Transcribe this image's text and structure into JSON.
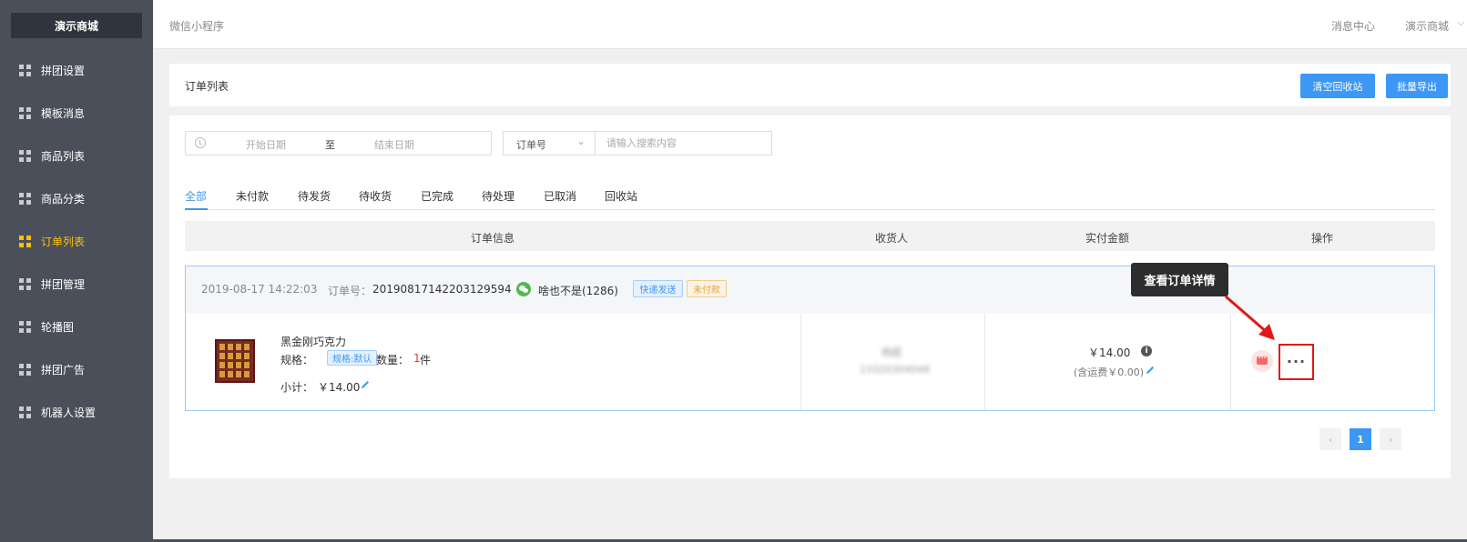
{
  "sidebar": {
    "brand": "演示商城",
    "items": [
      {
        "label": "拼团设置",
        "name": "sidebar-item-group-settings",
        "active": false
      },
      {
        "label": "模板消息",
        "name": "sidebar-item-template-messages",
        "active": false
      },
      {
        "label": "商品列表",
        "name": "sidebar-item-product-list",
        "active": false
      },
      {
        "label": "商品分类",
        "name": "sidebar-item-product-categories",
        "active": false
      },
      {
        "label": "订单列表",
        "name": "sidebar-item-order-list",
        "active": true
      },
      {
        "label": "拼团管理",
        "name": "sidebar-item-group-management",
        "active": false
      },
      {
        "label": "轮播图",
        "name": "sidebar-item-carousel",
        "active": false
      },
      {
        "label": "拼团广告",
        "name": "sidebar-item-group-ads",
        "active": false
      },
      {
        "label": "机器人设置",
        "name": "sidebar-item-robot-settings",
        "active": false
      }
    ]
  },
  "topbar": {
    "breadcrumb": "微信小程序",
    "message_center": "消息中心",
    "shop_name": "演示商城"
  },
  "header": {
    "title": "订单列表",
    "clear_recycle_label": "清空回收站",
    "export_label": "批量导出"
  },
  "filters": {
    "start_date_placeholder": "开始日期",
    "to_label": "至",
    "end_date_placeholder": "结束日期",
    "search_type": "订单号",
    "search_placeholder": "请输入搜索内容"
  },
  "tabs": [
    "全部",
    "未付款",
    "待发货",
    "待收货",
    "已完成",
    "待处理",
    "已取消",
    "回收站"
  ],
  "active_tab": "全部",
  "table": {
    "columns": [
      "订单信息",
      "收货人",
      "实付金额",
      "操作"
    ]
  },
  "order": {
    "date": "2019-08-17 14:22:03",
    "order_no_label": "订单号：",
    "order_no": "20190817142203129594",
    "buyer": "啥也不是(1286)",
    "ship_badge": "快递发送",
    "status_badge": "未付款",
    "product_name": "黑金刚巧克力",
    "spec_label": "规格：",
    "spec_value": "规格:默认",
    "qty_label": "数量：",
    "qty_value": "1",
    "qty_unit": "件",
    "subtotal_label": "小计：",
    "subtotal_value": "￥14.00",
    "receiver_name": "杨超",
    "receiver_phone": "13320304048",
    "amount": "￥14.00",
    "shipping_note": "(含运费￥0.00)"
  },
  "tooltip": "查看订单详情",
  "pagination": {
    "prev": "‹",
    "current": "1",
    "next": "›"
  },
  "colors": {
    "sidebar_bg": "#4a4f59",
    "accent": "#3c97f5",
    "active_nav": "#ffc107",
    "highlight_box": "#e01818"
  }
}
